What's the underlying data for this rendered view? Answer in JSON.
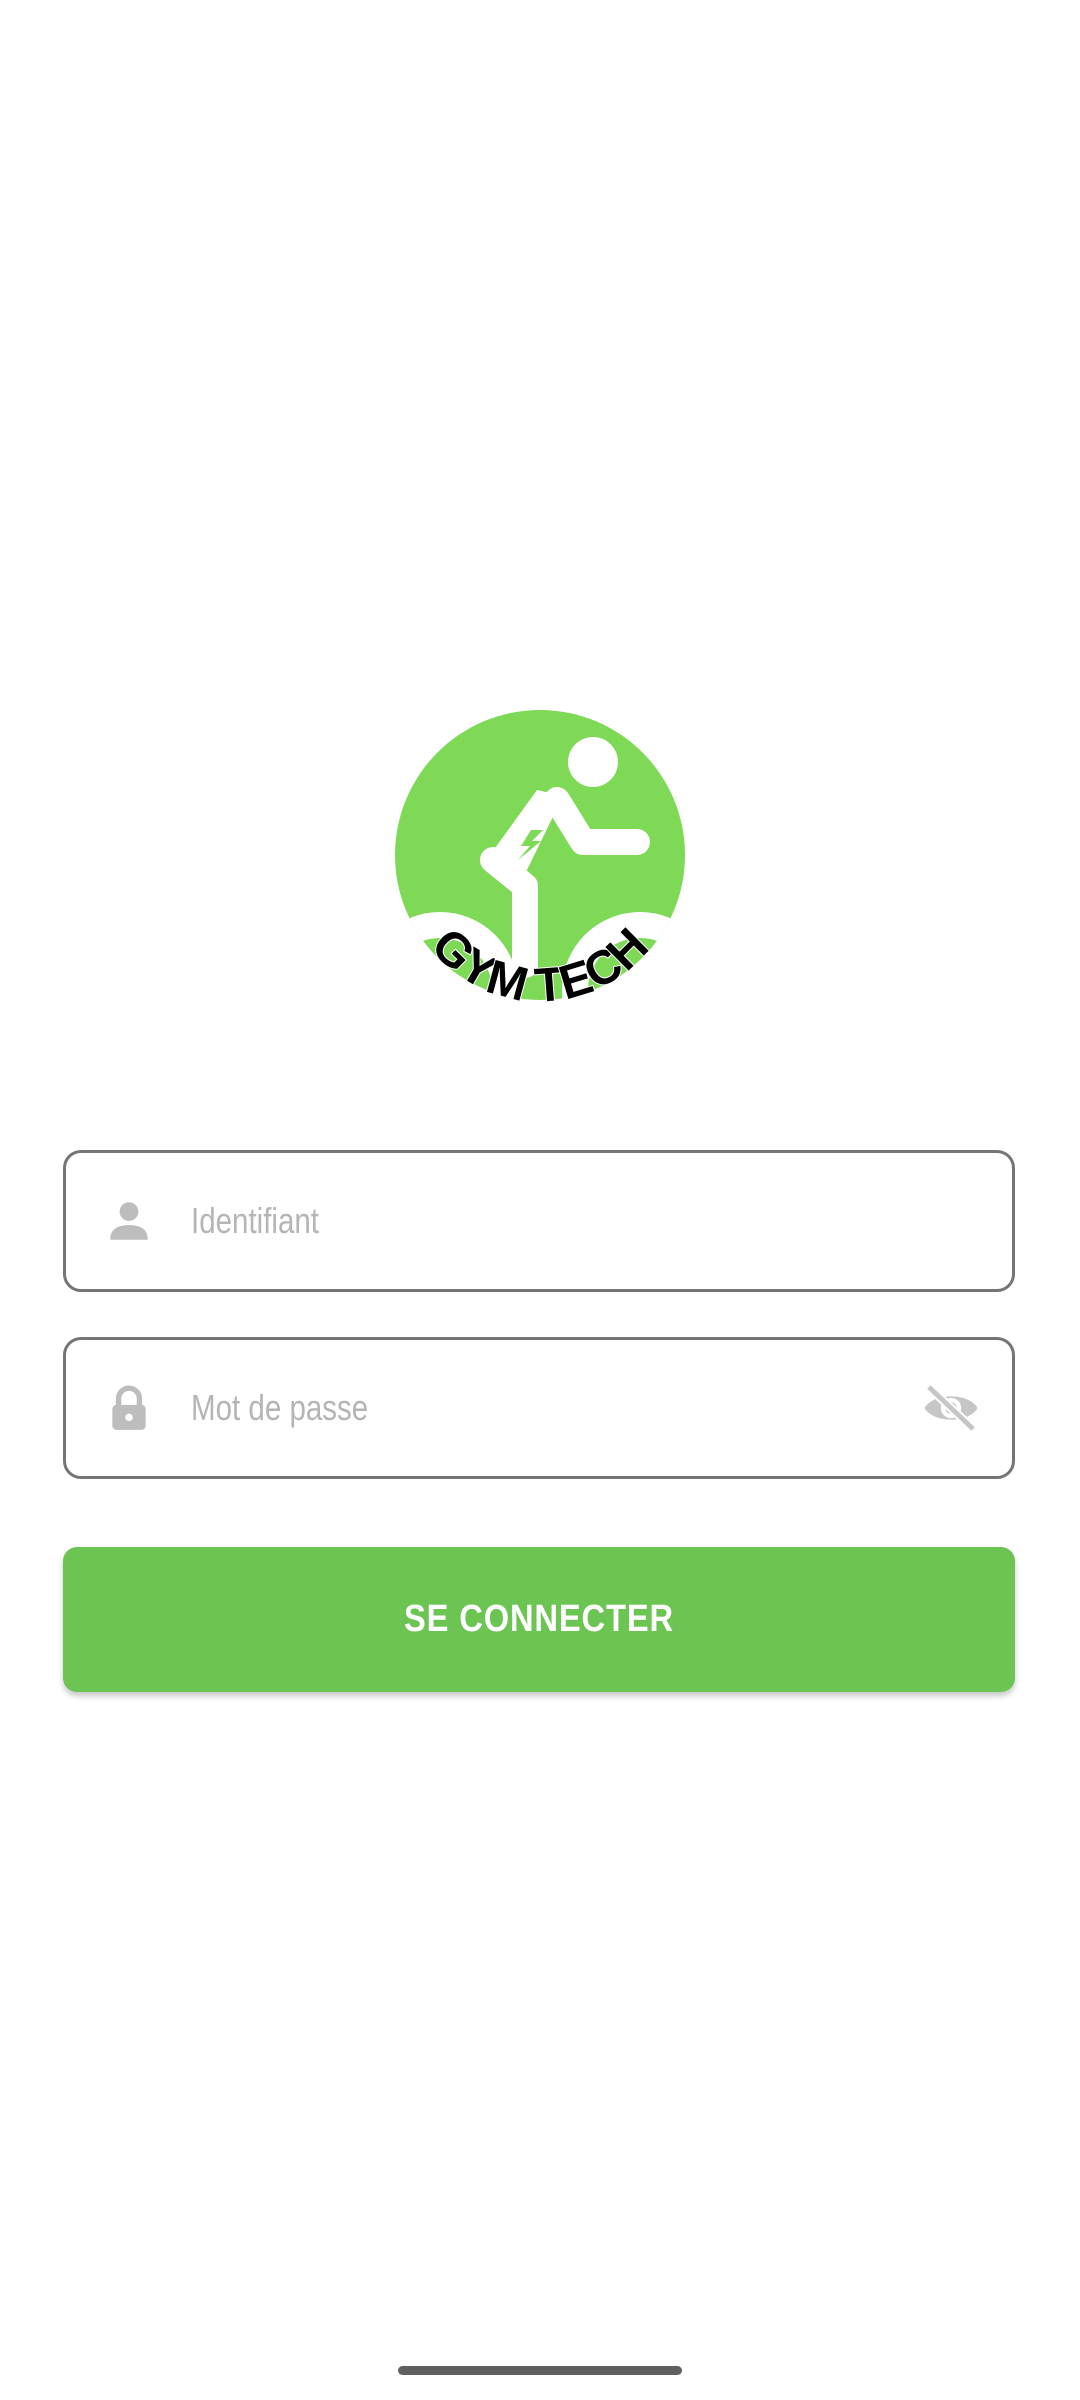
{
  "app": {
    "logo_text": "GYM TECH",
    "brand_color": "#7ed957"
  },
  "login_form": {
    "username": {
      "placeholder": "Identifiant",
      "value": "",
      "icon": "person-icon"
    },
    "password": {
      "placeholder": "Mot de passe",
      "value": "",
      "icon": "lock-icon",
      "toggle_icon": "eye-off-icon"
    },
    "submit_label": "SE CONNECTER",
    "submit_color": "#6cc553"
  }
}
